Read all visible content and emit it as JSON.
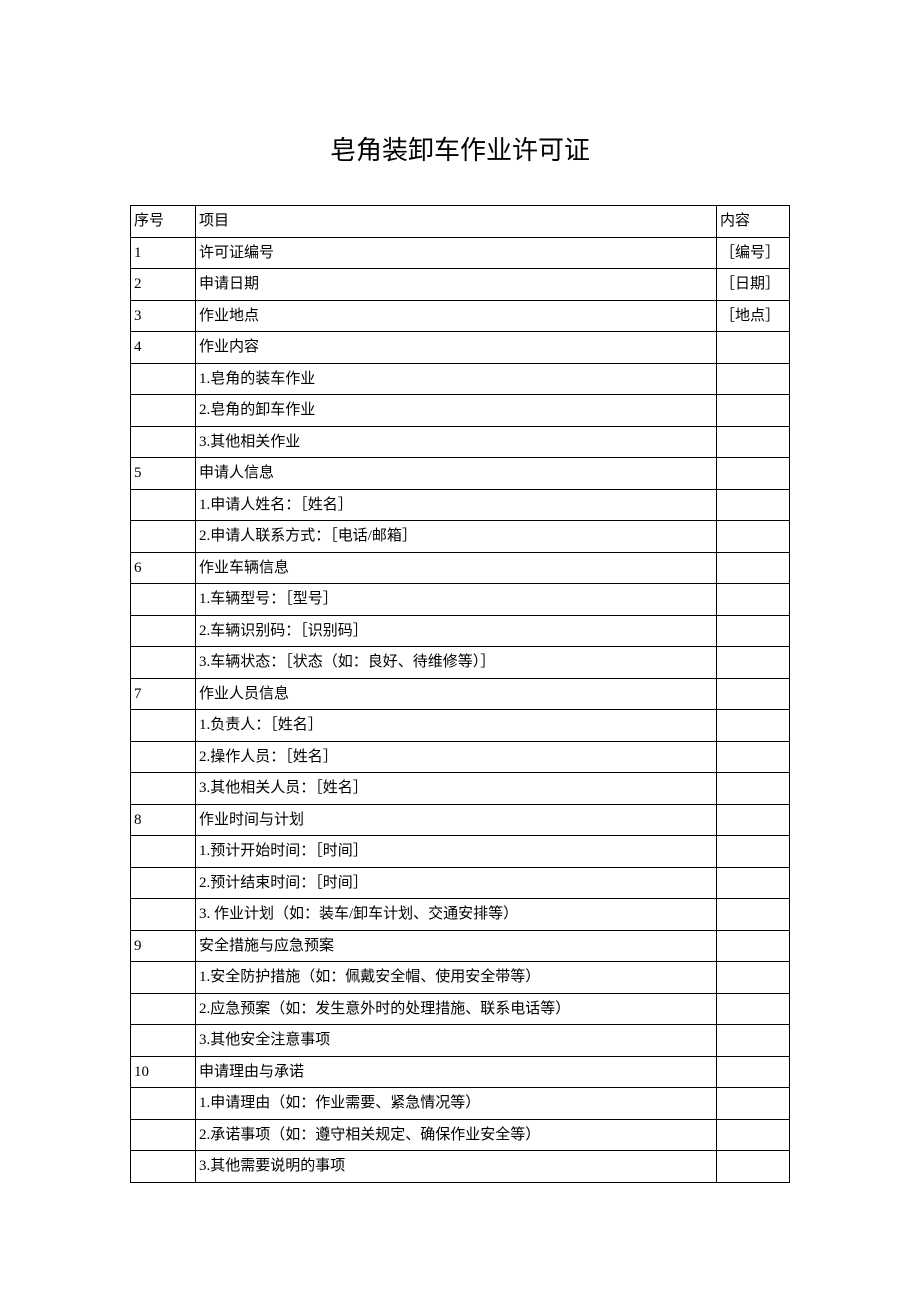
{
  "title": "皂角装卸车作业许可证",
  "headers": {
    "num": "序号",
    "item": "项目",
    "content": "内容"
  },
  "rows": [
    {
      "num": "1",
      "item": "许可证编号",
      "content": "［编号］"
    },
    {
      "num": "2",
      "item": "申请日期",
      "content": "［日期］"
    },
    {
      "num": "3",
      "item": "作业地点",
      "content": "［地点］"
    },
    {
      "num": "4",
      "item": "作业内容",
      "content": ""
    },
    {
      "num": "",
      "item": "1.皂角的装车作业",
      "content": ""
    },
    {
      "num": "",
      "item": "2.皂角的卸车作业",
      "content": ""
    },
    {
      "num": "",
      "item": "3.其他相关作业",
      "content": ""
    },
    {
      "num": "5",
      "item": "申请人信息",
      "content": ""
    },
    {
      "num": "",
      "item": "1.申请人姓名：［姓名］",
      "content": ""
    },
    {
      "num": "",
      "item": "2.申请人联系方式：［电话/邮箱］",
      "content": ""
    },
    {
      "num": "6",
      "item": "作业车辆信息",
      "content": ""
    },
    {
      "num": "",
      "item": "1.车辆型号：［型号］",
      "content": ""
    },
    {
      "num": "",
      "item": "2.车辆识别码：［识别码］",
      "content": ""
    },
    {
      "num": "",
      "item": "3.车辆状态：［状态（如：良好、待维修等）］",
      "content": ""
    },
    {
      "num": "7",
      "item": "作业人员信息",
      "content": ""
    },
    {
      "num": "",
      "item": "1.负责人：［姓名］",
      "content": ""
    },
    {
      "num": "",
      "item": "2.操作人员：［姓名］",
      "content": ""
    },
    {
      "num": "",
      "item": "3.其他相关人员：［姓名］",
      "content": ""
    },
    {
      "num": "8",
      "item": "作业时间与计划",
      "content": ""
    },
    {
      "num": "",
      "item": "1.预计开始时间：［时间］",
      "content": ""
    },
    {
      "num": "",
      "item": "2.预计结束时间：［时间］",
      "content": ""
    },
    {
      "num": "",
      "item": "3. 作业计划（如：装车/卸车计划、交通安排等）",
      "content": ""
    },
    {
      "num": "9",
      "item": "安全措施与应急预案",
      "content": ""
    },
    {
      "num": "",
      "item": "1.安全防护措施（如：佩戴安全帽、使用安全带等）",
      "content": ""
    },
    {
      "num": "",
      "item": "2.应急预案（如：发生意外时的处理措施、联系电话等）",
      "content": ""
    },
    {
      "num": "",
      "item": "3.其他安全注意事项",
      "content": ""
    },
    {
      "num": "10",
      "item": "申请理由与承诺",
      "content": ""
    },
    {
      "num": "",
      "item": "1.申请理由（如：作业需要、紧急情况等）",
      "content": ""
    },
    {
      "num": "",
      "item": "2.承诺事项（如：遵守相关规定、确保作业安全等）",
      "content": ""
    },
    {
      "num": "",
      "item": "3.其他需要说明的事项",
      "content": ""
    }
  ]
}
